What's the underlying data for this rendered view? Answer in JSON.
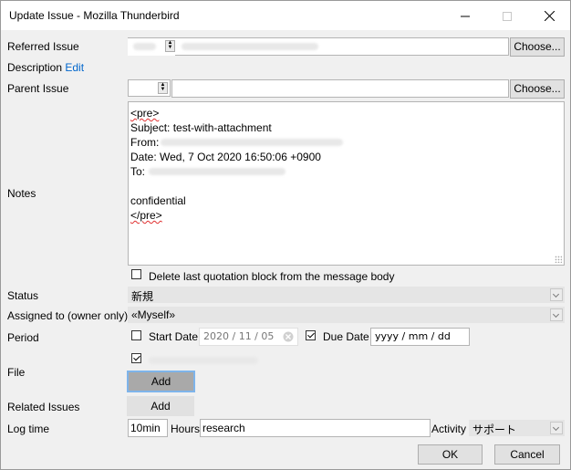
{
  "window": {
    "title": "Update Issue - Mozilla Thunderbird"
  },
  "labels": {
    "referred_issue": "Referred Issue",
    "description": "Description",
    "description_edit": "Edit",
    "parent_issue": "Parent Issue",
    "notes": "Notes",
    "status": "Status",
    "assigned": "Assigned to (owner only)",
    "period": "Period",
    "file": "File",
    "related_issues": "Related Issues",
    "log_time": "Log time"
  },
  "buttons": {
    "choose": "Choose...",
    "add": "Add",
    "ok": "OK",
    "cancel": "Cancel"
  },
  "notes": {
    "line1": "<pre>",
    "line2": "Subject: test-with-attachment",
    "from_label": "From:",
    "line4": "Date: Wed, 7 Oct 2020 16:50:06 +0900",
    "to_label": "To:",
    "line7": "confidential",
    "line8": "</pre>"
  },
  "options": {
    "delete_last_quote": "Delete last quotation block from the message body",
    "delete_last_quote_checked": false
  },
  "status": {
    "value": "新規"
  },
  "assigned": {
    "value": "«Myself»"
  },
  "period": {
    "start_label": "Start Date",
    "start_value": "2020 / 11 / 05",
    "start_checked": false,
    "due_label": "Due Date",
    "due_value": "yyyy / mm / dd",
    "due_checked": true
  },
  "file": {
    "attachment_checked": true
  },
  "log_time": {
    "hours_value": "10min",
    "hours_label": "Hours",
    "comment_value": "research",
    "activity_label": "Activity",
    "activity_value": "サポート"
  }
}
